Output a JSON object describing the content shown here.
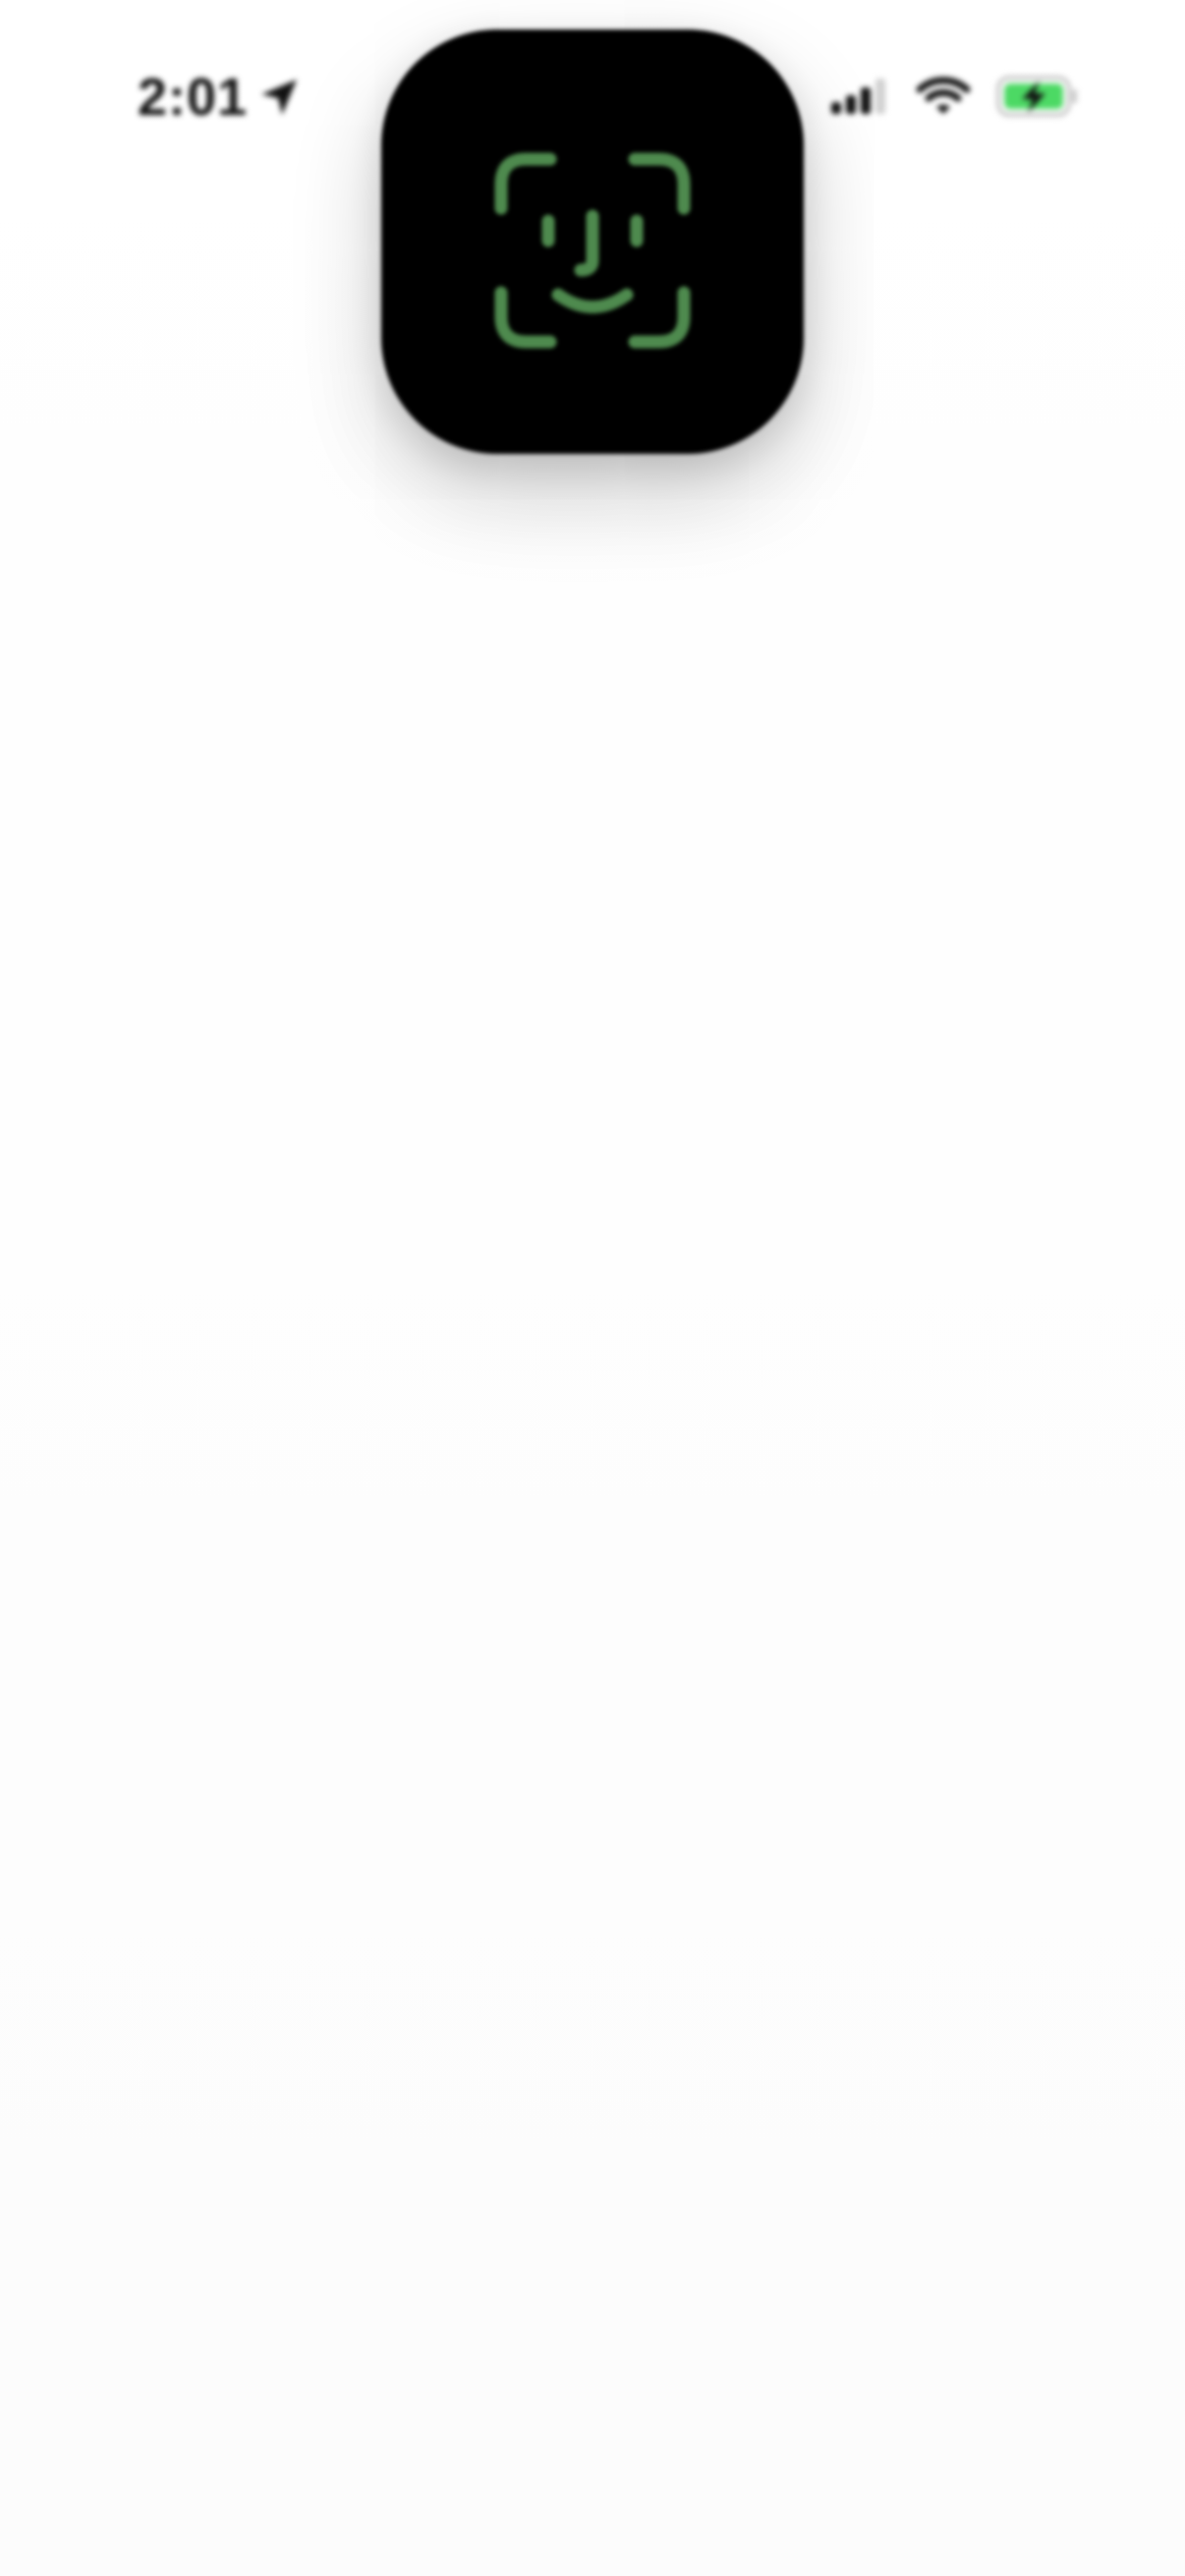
{
  "status_bar": {
    "time": "2:01",
    "location_icon": "location-arrow-icon",
    "signal_icon": "cellular-signal-icon",
    "wifi_icon": "wifi-icon",
    "battery_icon": "battery-charging-icon",
    "battery_color": "#4cd964"
  },
  "faceid": {
    "icon": "face-id-icon",
    "accent_color": "#4e8a4e",
    "card_color": "#000000"
  }
}
